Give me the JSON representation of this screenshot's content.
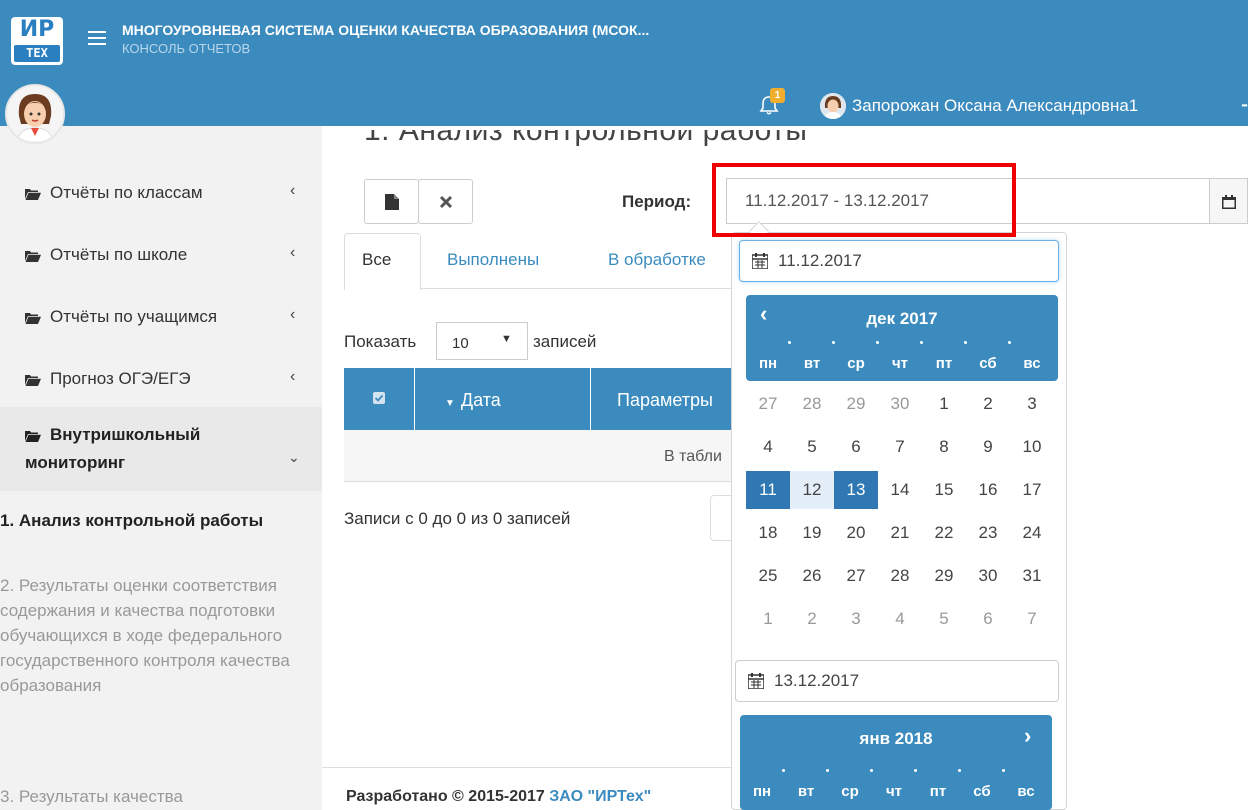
{
  "header": {
    "logo_top": "ИР",
    "logo_bottom": "ТЕХ",
    "title": "МНОГОУРОВНЕВАЯ СИСТЕМА ОЦЕНКИ КАЧЕСТВА ОБРАЗОВАНИЯ (МСОК...",
    "subtitle": "КОНСОЛЬ ОТЧЕТОВ",
    "notification_count": "1",
    "user_name": "Запорожан Оксана Александровна1"
  },
  "sidebar": {
    "items": [
      {
        "label": "Отчёты по классам"
      },
      {
        "label": "Отчёты по школе"
      },
      {
        "label": "Отчёты по учащимся"
      },
      {
        "label": "Прогноз ОГЭ/ЕГЭ"
      },
      {
        "label_line1": "Внутришкольный",
        "label_line2": "мониторинг"
      }
    ],
    "subitems": {
      "active": "1. Анализ контрольной работы",
      "item2": "2. Результаты оценки соответствия содержания и качества подготовки обучающихся в ходе федерального государственного контроля качества образования",
      "item3": "3. Результаты качества"
    }
  },
  "main": {
    "heading": "1. Анализ контрольной работы",
    "period_label": "Период:",
    "period_value": "11.12.2017 - 13.12.2017",
    "tabs": [
      "Все",
      "Выполнены",
      "В обработке"
    ],
    "show_prefix": "Показать",
    "show_value": "10",
    "show_suffix": "записей",
    "columns": [
      "Дата",
      "Параметры"
    ],
    "empty_text": "В табли",
    "records_info": "Записи с 0 до 0 из 0 записей"
  },
  "footer": {
    "text": "Разработано © 2015-2017 ",
    "link": "ЗАО \"ИРТех\""
  },
  "picker": {
    "start_date": "11.12.2017",
    "end_date": "13.12.2017",
    "month1": "дек 2017",
    "month2": "янв 2018",
    "weekdays": [
      "пн",
      "вт",
      "ср",
      "чт",
      "пт",
      "сб",
      "вс"
    ],
    "weeks": [
      [
        "27",
        "28",
        "29",
        "30",
        "1",
        "2",
        "3"
      ],
      [
        "4",
        "5",
        "6",
        "7",
        "8",
        "9",
        "10"
      ],
      [
        "11",
        "12",
        "13",
        "14",
        "15",
        "16",
        "17"
      ],
      [
        "18",
        "19",
        "20",
        "21",
        "22",
        "23",
        "24"
      ],
      [
        "25",
        "26",
        "27",
        "28",
        "29",
        "30",
        "31"
      ],
      [
        "1",
        "2",
        "3",
        "4",
        "5",
        "6",
        "7"
      ]
    ],
    "muted_cells": [
      [
        0,
        0
      ],
      [
        0,
        1
      ],
      [
        0,
        2
      ],
      [
        0,
        3
      ],
      [
        5,
        0
      ],
      [
        5,
        1
      ],
      [
        5,
        2
      ],
      [
        5,
        3
      ],
      [
        5,
        4
      ],
      [
        5,
        5
      ],
      [
        5,
        6
      ]
    ],
    "selected_cells": [
      [
        2,
        0
      ],
      [
        2,
        2
      ]
    ],
    "range_cells": [
      [
        2,
        1
      ]
    ]
  },
  "colors": {
    "primary": "#3b8bbf",
    "selected_day": "#2f78b3",
    "range_day": "#e3eef8",
    "badge": "#f0ad2e",
    "highlight_box": "#ee0000"
  }
}
